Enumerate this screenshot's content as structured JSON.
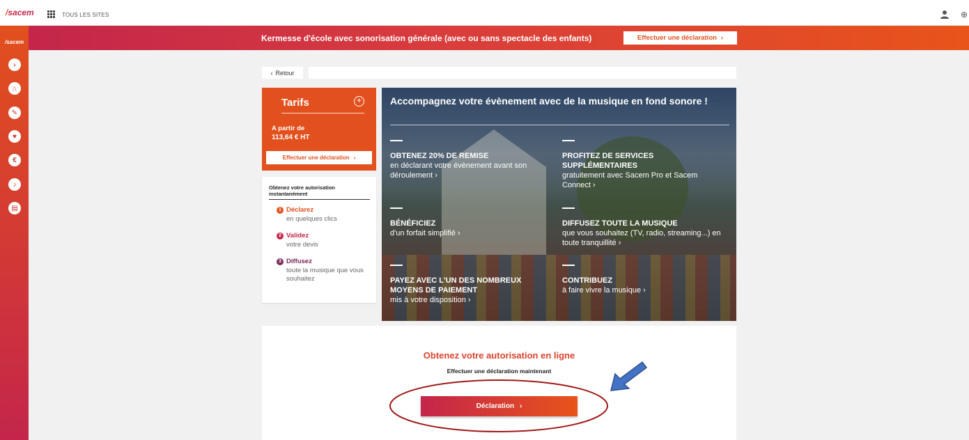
{
  "topbar": {
    "logo": "sacem",
    "all_sites": "TOUS LES SITES",
    "icons": [
      "grid-icon",
      "user-icon",
      "globe-icon"
    ]
  },
  "rail": {
    "logo": "sacem",
    "items": [
      {
        "icon": "chevron-right-icon",
        "glyph": "›"
      },
      {
        "icon": "home-icon",
        "glyph": "⌂"
      },
      {
        "icon": "pencil-icon",
        "glyph": "✎"
      },
      {
        "icon": "user-heart-icon",
        "glyph": "♥"
      },
      {
        "icon": "euro-icon",
        "glyph": "€"
      },
      {
        "icon": "guitar-icon",
        "glyph": "♪"
      },
      {
        "icon": "table-icon",
        "glyph": "▤"
      }
    ]
  },
  "banner": {
    "title": "Kermesse d'école avec sonorisation générale (avec ou sans spectacle des enfants)",
    "button": "Effectuer une déclaration",
    "button_chevron": "›"
  },
  "nav": {
    "back": "Retour",
    "back_chevron": "‹"
  },
  "tarifs": {
    "title": "Tarifs",
    "plus": "+",
    "price_from": "A partir de",
    "price_value": "113,64 € HT",
    "button": "Effectuer une déclaration",
    "button_chevron": "›"
  },
  "steps": {
    "heading": "Obtenez votre autorisation instantanément",
    "items": [
      {
        "num": "1",
        "title": "Déclarez",
        "desc": "en quelques clics",
        "color": "#e2501d"
      },
      {
        "num": "2",
        "title": "Validez",
        "desc": "votre devis",
        "color": "#c3264a"
      },
      {
        "num": "3",
        "title": "Diffusez",
        "desc": "toute la musique que vous souhaitez",
        "color": "#7a2a5a"
      }
    ]
  },
  "hero": {
    "title": "Accompagnez votre évènement avec de la musique en fond sonore !",
    "features": [
      {
        "title": "OBTENEZ 20% DE REMISE",
        "text": "en déclarant votre évènement avant son déroulement ›"
      },
      {
        "title": "PROFITEZ DE SERVICES SUPPLÉMENTAIRES",
        "text": "gratuitement avec Sacem Pro et Sacem Connect ›"
      },
      {
        "title": "BÉNÉFICIEZ",
        "text": "d'un forfait simplifié ›"
      },
      {
        "title": "DIFFUSEZ TOUTE LA MUSIQUE",
        "text": "que vous souhaitez (TV, radio, streaming...) en toute tranquillité ›"
      },
      {
        "title": "PAYEZ AVEC L'UN DES NOMBREUX MOYENS DE PAIEMENT",
        "text": "mis à votre disposition ›"
      },
      {
        "title": "CONTRIBUEZ",
        "text": "à faire vivre la musique ›"
      }
    ]
  },
  "cta": {
    "title": "Obtenez votre autorisation en ligne",
    "subtitle": "Effectuer une déclaration maintenant",
    "button": "Déclaration",
    "button_chevron": "›"
  },
  "colors": {
    "brand_red": "#c3264a",
    "brand_orange": "#e2501d",
    "annotation_circle": "#a01818",
    "annotation_arrow": "#3b6fc4"
  }
}
